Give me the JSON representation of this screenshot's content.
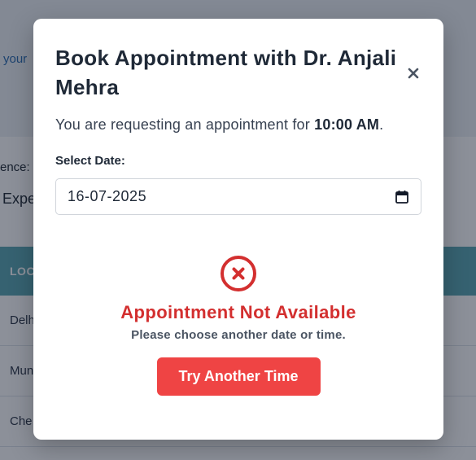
{
  "background": {
    "subtitle": "your",
    "filter_label": "ence:",
    "filter_value": "Expe",
    "table_header": "LOC",
    "rows": [
      "Delh",
      "Mun",
      "Che"
    ]
  },
  "modal": {
    "title": "Book Appointment with Dr. Anjali Mehra",
    "close_icon": "close-icon",
    "request_prefix": "You are requesting an appointment for",
    "request_time": "10:00 AM",
    "request_suffix": ".",
    "date_label": "Select Date:",
    "date_value": "16-07-2025",
    "calendar_icon": "calendar-icon",
    "status_icon": "x-circle-icon",
    "status_title": "Appointment Not Available",
    "status_subtitle": "Please choose another date or time.",
    "try_button": "Try Another Time"
  },
  "colors": {
    "error": "#d32f2f",
    "button": "#ef4444",
    "table_header": "#5aa8b2"
  }
}
